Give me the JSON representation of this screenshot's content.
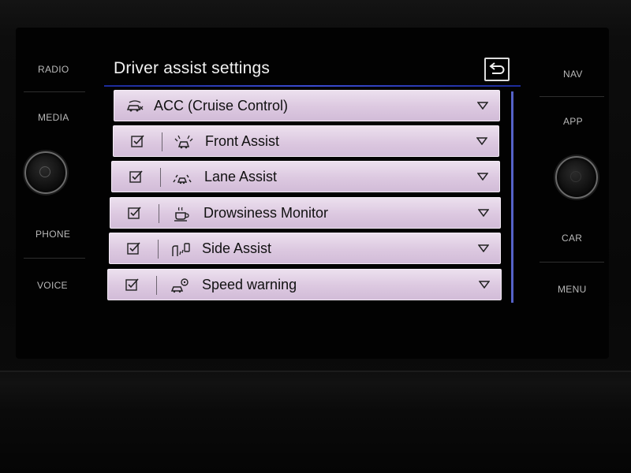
{
  "left_buttons": [
    "RADIO",
    "MEDIA",
    "PHONE",
    "VOICE"
  ],
  "right_buttons": [
    "NAV",
    "APP",
    "CAR",
    "MENU"
  ],
  "screen": {
    "title": "Driver assist settings",
    "back_icon": "back-arrow-icon",
    "accent_color": "#3a4bd0",
    "items": [
      {
        "label": "ACC (Cruise Control)",
        "icon": "acc-icon",
        "checkbox": false
      },
      {
        "label": "Front Assist",
        "icon": "front-assist-icon",
        "checkbox": true,
        "checked": true
      },
      {
        "label": "Lane Assist",
        "icon": "lane-assist-icon",
        "checkbox": true,
        "checked": true
      },
      {
        "label": "Drowsiness Monitor",
        "icon": "coffee-cup-icon",
        "checkbox": true,
        "checked": true
      },
      {
        "label": "Side Assist",
        "icon": "side-assist-icon",
        "checkbox": true,
        "checked": true
      },
      {
        "label": "Speed warning",
        "icon": "speed-warning-icon",
        "checkbox": true,
        "checked": true
      }
    ]
  }
}
